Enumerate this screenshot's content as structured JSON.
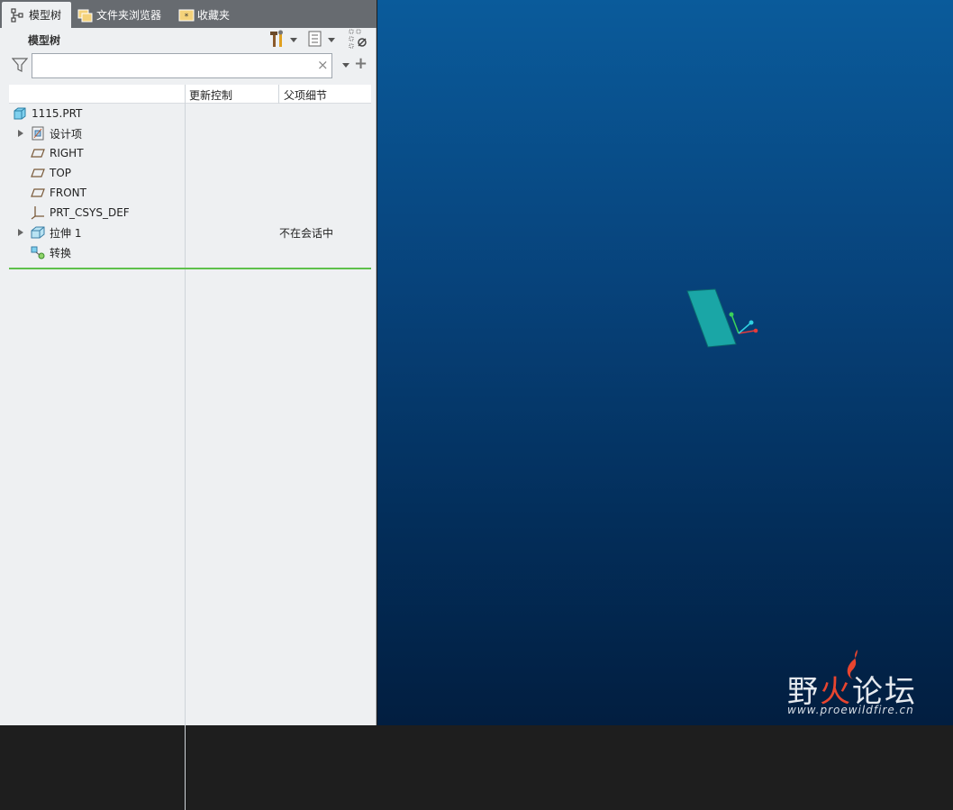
{
  "tabs": [
    {
      "label": "模型树",
      "icon": "model-tree-icon"
    },
    {
      "label": "文件夹浏览器",
      "icon": "folder-browser-icon"
    },
    {
      "label": "收藏夹",
      "icon": "favorites-icon"
    }
  ],
  "panel": {
    "title": "模型树",
    "toolbar": {
      "tools_icon": "hammer-wrench-icon",
      "show_icon": "list-icon",
      "settings_icon": "tree-settings-icon"
    }
  },
  "search": {
    "value": "",
    "placeholder": "",
    "clear_icon": "×",
    "add_icon": "+"
  },
  "columns": [
    "更新控制",
    "父项细节"
  ],
  "tree": [
    {
      "label": "1115.PRT",
      "icon": "part-icon",
      "expandable": false,
      "status": ""
    },
    {
      "label": "设计项",
      "icon": "design-items-icon",
      "expandable": true,
      "status": ""
    },
    {
      "label": "RIGHT",
      "icon": "datum-plane-icon",
      "expandable": false,
      "status": ""
    },
    {
      "label": "TOP",
      "icon": "datum-plane-icon",
      "expandable": false,
      "status": ""
    },
    {
      "label": "FRONT",
      "icon": "datum-plane-icon",
      "expandable": false,
      "status": ""
    },
    {
      "label": "PRT_CSYS_DEF",
      "icon": "coordinate-system-icon",
      "expandable": false,
      "status": ""
    },
    {
      "label": "拉伸 1",
      "icon": "extrude-icon",
      "expandable": true,
      "status": "不在会话中"
    },
    {
      "label": "转换",
      "icon": "transform-icon",
      "expandable": false,
      "status": ""
    }
  ],
  "viewport": {
    "background_top": "#0a5b9b",
    "background_bottom": "#021e40",
    "model_color": "#1aa6a6",
    "axis_colors": {
      "x": "#e53b3b",
      "y": "#3bd15a",
      "z": "#2fd0e0"
    }
  },
  "watermark": {
    "title_a": "野",
    "title_b": "火",
    "title_c": "论坛",
    "url": "www.proewildfire.cn"
  }
}
